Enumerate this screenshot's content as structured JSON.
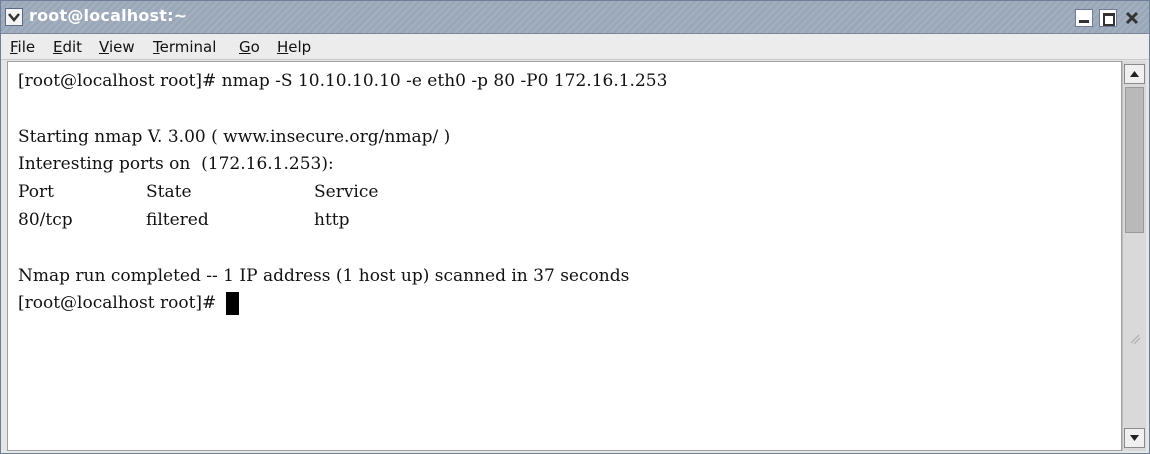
{
  "window": {
    "title": "root@localhost:~"
  },
  "menubar": {
    "items": [
      {
        "key": "F",
        "rest": "ile"
      },
      {
        "key": "E",
        "rest": "dit"
      },
      {
        "key": "V",
        "rest": "iew"
      },
      {
        "key": "T",
        "rest": "erminal"
      },
      {
        "key": "G",
        "rest": "o"
      },
      {
        "key": "H",
        "rest": "elp"
      }
    ]
  },
  "terminal": {
    "lines": [
      "[root@localhost root]# nmap -S 10.10.10.10 -e eth0 -p 80 -P0 172.16.1.253",
      "",
      "Starting nmap V. 3.00 ( www.insecure.org/nmap/ )",
      "Interesting ports on  (172.16.1.253):"
    ],
    "table": {
      "headers": [
        "Port",
        "State",
        "Service"
      ],
      "rows": [
        [
          "80/tcp",
          "filtered",
          "http"
        ]
      ]
    },
    "footer_lines": [
      "",
      "Nmap run completed -- 1 IP address (1 host up) scanned in 37 seconds"
    ],
    "prompt": "[root@localhost root]# "
  },
  "icons": {
    "window_menu": "chevron-down-icon",
    "minimize": "minimize-icon",
    "maximize": "maximize-icon",
    "close": "close-icon",
    "scroll_up": "arrow-up-icon",
    "scroll_down": "arrow-down-icon"
  },
  "colors": {
    "titlebar": "#9aa7b9",
    "terminal_bg": "#ffffff",
    "terminal_fg": "#111111"
  }
}
